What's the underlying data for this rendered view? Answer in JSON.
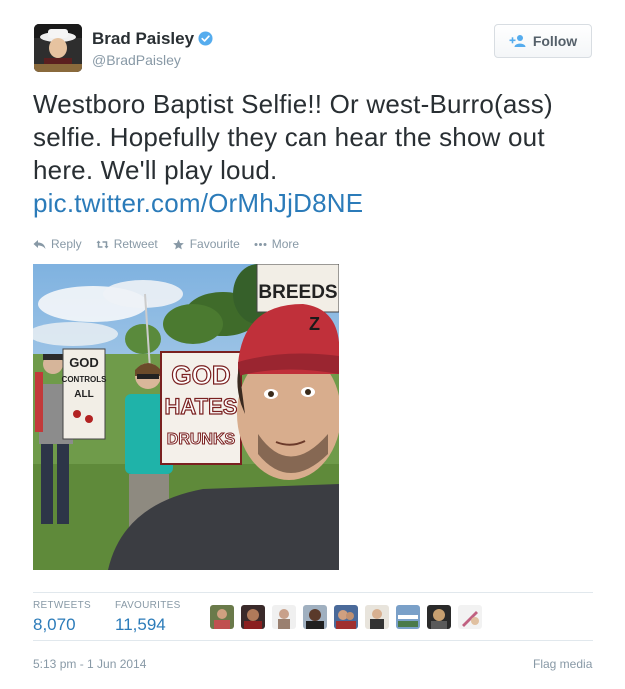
{
  "user": {
    "name": "Brad Paisley",
    "handle": "@BradPaisley"
  },
  "follow_button": {
    "label": "Follow"
  },
  "tweet": {
    "text": "Westboro Baptist Selfie!! Or west-Burro(ass) selfie. Hopefully they can hear the show out here. We'll play loud.",
    "link": "pic.twitter.com/OrMhJjD8NE"
  },
  "actions": {
    "reply": "Reply",
    "retweet": "Retweet",
    "favourite": "Favourite",
    "more": "More"
  },
  "photo": {
    "signs": [
      "BREEDS",
      "GOD",
      "CONTROLS",
      "ALL",
      "GOD",
      "HATES",
      "DRUNKS"
    ]
  },
  "stats": {
    "retweets_label": "RETWEETS",
    "retweets_value": "8,070",
    "favourites_label": "FAVOURITES",
    "favourites_value": "11,594"
  },
  "footer": {
    "timestamp": "5:13 pm - 1 Jun 2014",
    "flag": "Flag media"
  },
  "colors": {
    "link": "#2b7bb9",
    "verified": "#55acee",
    "muted": "#8899a6"
  }
}
